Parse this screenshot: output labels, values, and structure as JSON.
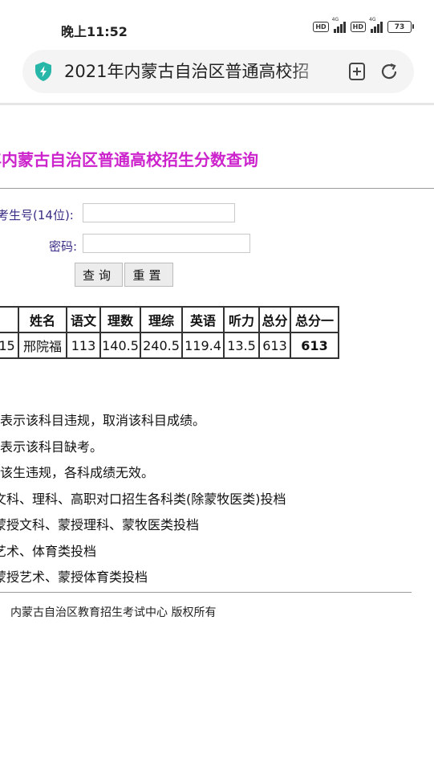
{
  "status_bar": {
    "time": "晚上11:52",
    "hd1": "HD",
    "hd2": "HD",
    "net1": "4G",
    "net2": "4G",
    "battery": "73"
  },
  "browser": {
    "url_title": "2021年内蒙古自治区普通高校招",
    "shield_color": "#26b7a8"
  },
  "page": {
    "title": "年内蒙古自治区普通高校招生分数查询",
    "form": {
      "exam_id_label": "考生号(14位):",
      "exam_id_value": "",
      "password_label": "密码:",
      "password_value": "",
      "query_button": "查询",
      "reset_button": "重置"
    },
    "table": {
      "headers": [
        "",
        "姓名",
        "语文",
        "理数",
        "理综",
        "英语",
        "听力",
        "总分",
        "总分一"
      ],
      "row": [
        "15",
        "邢院福",
        "113",
        "140.5",
        "240.5",
        "119.4",
        "13.5",
        "613",
        "613"
      ]
    },
    "notes": [
      "表示该科目违规，取消该科目成绩。",
      "表示该科目缺考。",
      "该生违规，各科成绩无效。",
      "文科、理科、高职对口招生各科类(除蒙牧医类)投档",
      "蒙授文科、蒙授理科、蒙牧医类投档",
      "艺术、体育类投档",
      "蒙授艺术、蒙授体育类投档"
    ],
    "footer": "内蒙古自治区教育招生考试中心 版权所有"
  }
}
